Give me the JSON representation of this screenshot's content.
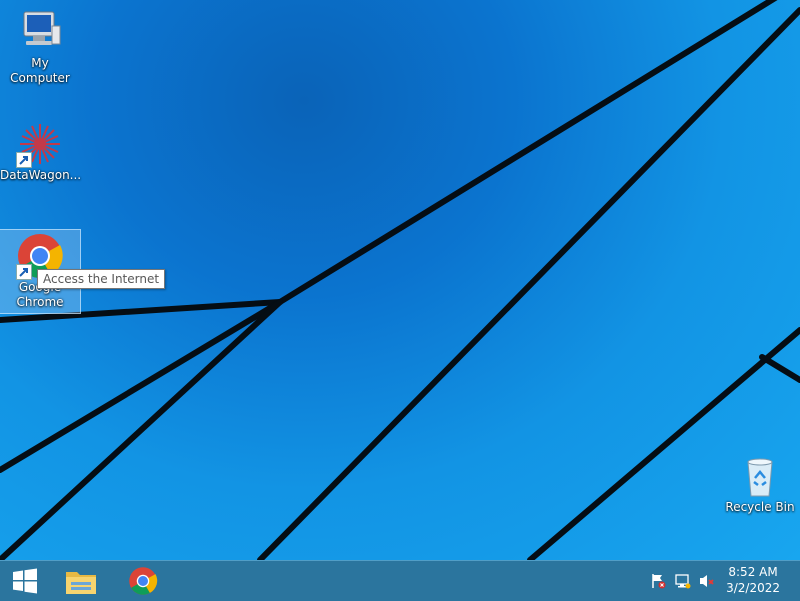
{
  "desktop": {
    "icons": [
      {
        "label": "My Computer"
      },
      {
        "label": "DataWagon..."
      },
      {
        "label": "Google Chrome"
      },
      {
        "label": "Recycle Bin"
      }
    ],
    "tooltip": "Access the Internet"
  },
  "taskbar": {
    "start_icon": "windows-logo-icon",
    "pinned": [
      "file-explorer-icon",
      "chrome-icon"
    ],
    "tray_icons": [
      "action-center-flag-icon",
      "network-icon",
      "volume-muted-icon"
    ],
    "time": "8:52 AM",
    "date": "3/2/2022"
  },
  "colors": {
    "taskbar": "#1969a0",
    "wallpaper": "#1294e4"
  }
}
